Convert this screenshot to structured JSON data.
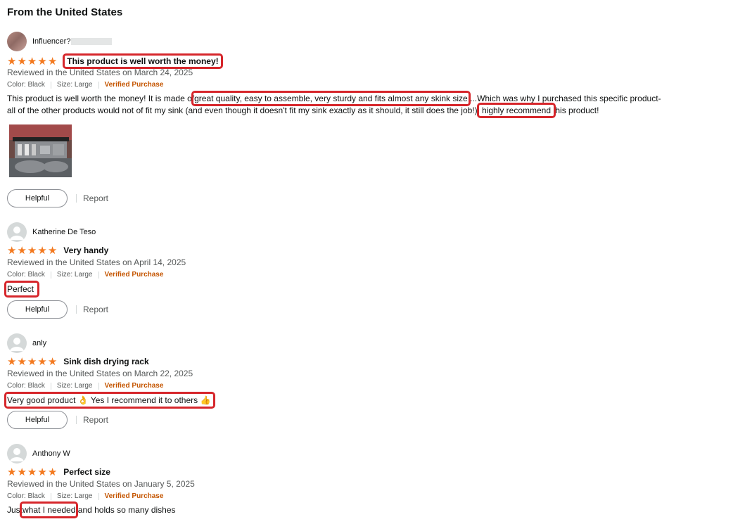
{
  "section_title": "From the United States",
  "labels": {
    "helpful": "Helpful",
    "report": "Report",
    "verified": "Verified Purchase"
  },
  "colors": {
    "star": "#f3791f",
    "verified": "#c45500",
    "highlight_box": "#d6262b"
  },
  "reviews": [
    {
      "reviewer": "Influencer",
      "reviewer_suffix": "?",
      "avatar": "profile-photo",
      "rating": 5,
      "title": "This product is well worth the money!",
      "title_highlighted": true,
      "date_text": "Reviewed in the United States on March 24, 2025",
      "color": "Color: Black",
      "size": "Size: Large",
      "body_parts": {
        "p1": "This product is well worth the money! It is made of",
        "h1": "great quality, easy to assemble, very sturdy and fits almost any skink size",
        "p2": "...Which was why I purchased this specific product-",
        "p3": "all of the other products would not of fit my sink (and even though it doesn't fit my sink exactly as it should, it still does the job!)",
        "h2": "highly recommend",
        "p4": "his product!"
      },
      "has_photo": true
    },
    {
      "reviewer": "Katherine De Teso",
      "avatar": "default-avatar",
      "rating": 5,
      "title": "Very handy",
      "date_text": "Reviewed in the United States on April 14, 2025",
      "color": "Color: Black",
      "size": "Size: Large",
      "body_highlight": "Perfect"
    },
    {
      "reviewer": "anly",
      "avatar": "default-avatar",
      "rating": 5,
      "title": "Sink dish drying rack",
      "date_text": "Reviewed in the United States on March 22, 2025",
      "color": "Color: Black",
      "size": "Size: Large",
      "body_a": "Very good product",
      "emoji_a": "👌",
      "body_b": "Yes I recommend it to others",
      "emoji_b": "👍"
    },
    {
      "reviewer": "Anthony W",
      "avatar": "default-avatar",
      "rating": 5,
      "title": "Perfect size",
      "date_text": "Reviewed in the United States on January 5, 2025",
      "color": "Color: Black",
      "size": "Size: Large",
      "body_prefix": "Just",
      "body_highlight": "what I needed",
      "body_suffix": "and holds so many dishes"
    }
  ]
}
